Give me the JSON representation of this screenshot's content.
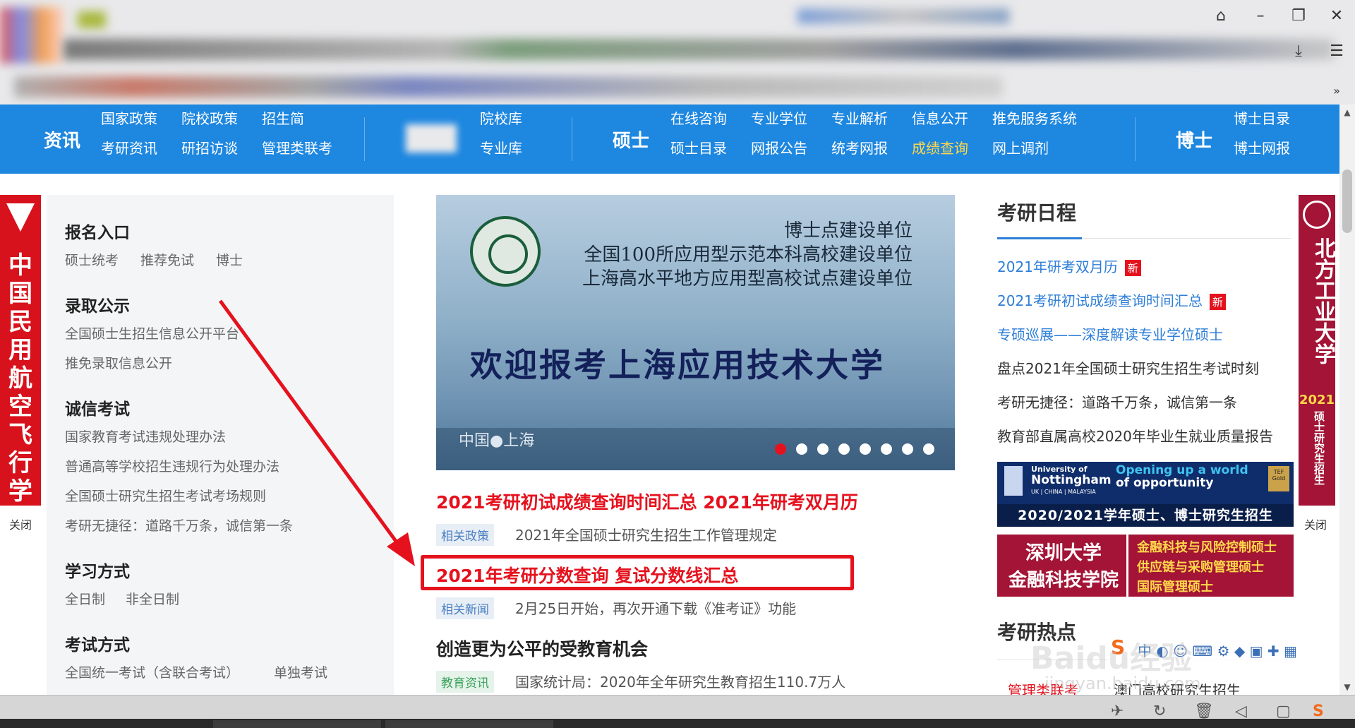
{
  "window": {
    "controls": [
      "minimize-icon",
      "restore-icon",
      "close-icon"
    ]
  },
  "nav": {
    "sec1": "资讯",
    "sec1_links": [
      "国家政策",
      "院校政策",
      "招生简",
      "考研资讯",
      "研招访谈",
      "管理类联考"
    ],
    "sec2_links": [
      "院校库",
      "专业库"
    ],
    "sec3": "硕士",
    "sec3_links": [
      "在线咨询",
      "专业学位",
      "专业解析",
      "信息公开",
      "推免服务系统",
      "硕士目录",
      "网报公告",
      "统考网报",
      "成绩查询",
      "网上调剂"
    ],
    "sec4": "博士",
    "sec4_links": [
      "博士目录",
      "博士网报"
    ]
  },
  "left_ad": {
    "text": "中国民用航空飞行学院",
    "close": "关闭"
  },
  "right_ad": {
    "text": "北方工业大学",
    "year": "2021",
    "sub": "硕士研究生招生",
    "close": "关闭"
  },
  "menu": {
    "s1": {
      "title": "报名入口",
      "items": [
        "硕士统考",
        "推荐免试",
        "博士"
      ]
    },
    "s2": {
      "title": "录取公示",
      "items": [
        "全国硕士生招生信息公开平台",
        "推免录取信息公开"
      ]
    },
    "s3": {
      "title": "诚信考试",
      "items": [
        "国家教育考试违规处理办法",
        "普通高等学校招生违规行为处理办法",
        "全国硕士研究生招生考试考场规则",
        "考研无捷径：道路千万条，诚信第一条"
      ]
    },
    "s4": {
      "title": "学习方式",
      "items": [
        "全日制",
        "非全日制"
      ]
    },
    "s5": {
      "title": "考试方式",
      "items": [
        "全国统一考试（含联合考试）",
        "单独考试"
      ]
    }
  },
  "banner": {
    "line1": "博士点建设单位",
    "line2": "全国100所应用型示范本科高校建设单位",
    "line3": "上海高水平地方应用型高校试点建设单位",
    "title": "欢迎报考上海应用技术大学",
    "place": "中国●上海"
  },
  "news": {
    "h1": "2021考研初试成绩查询时间汇总 2021年研考双月历",
    "t1": "相关政策",
    "s1": "2021年全国硕士研究生招生工作管理规定",
    "h2": "2021年考研分数查询 复试分数线汇总",
    "t2": "相关新闻",
    "s2": "2月25日开始，再次开通下载《准考证》功能",
    "h3": "创造更为公平的受教育机会",
    "t3": "教育资讯",
    "s3": "国家统计局：2020年全年研究生教育招生110.7万人"
  },
  "schedule": {
    "title": "考研日程",
    "new_badge": "新",
    "items": [
      "2021年研考双月历",
      "2021考研初试成绩查询时间汇总",
      "专硕巡展——深度解读专业学位硕士",
      "盘点2021年全国硕士研究生招生考试时刻",
      "考研无捷径：道路千万条，诚信第一条",
      "教育部直属高校2020年毕业生就业质量报告"
    ]
  },
  "ad_nottingham": {
    "l1": "University of",
    "l2": "Nottingham",
    "l3": "UK | CHINA | MALAYSIA",
    "r1": "Opening up a world",
    "r2": "of opportunity",
    "badge": "TEF Gold",
    "bottom": "2020/2021学年硕士、博士研究生招生"
  },
  "ad_shenzhen": {
    "l1": "深圳大学",
    "l2": "金融科技学院",
    "r1": "金融科技与风险控制硕士",
    "r2": "供应链与采购管理硕士",
    "r3": "国际管理硕士"
  },
  "hot": {
    "title": "考研热点",
    "tab1": "管理类联考",
    "tab2": "澳门高校研究生招生"
  },
  "watermark": "Baidu经验",
  "watermark2": "jingyan.baidu.com"
}
